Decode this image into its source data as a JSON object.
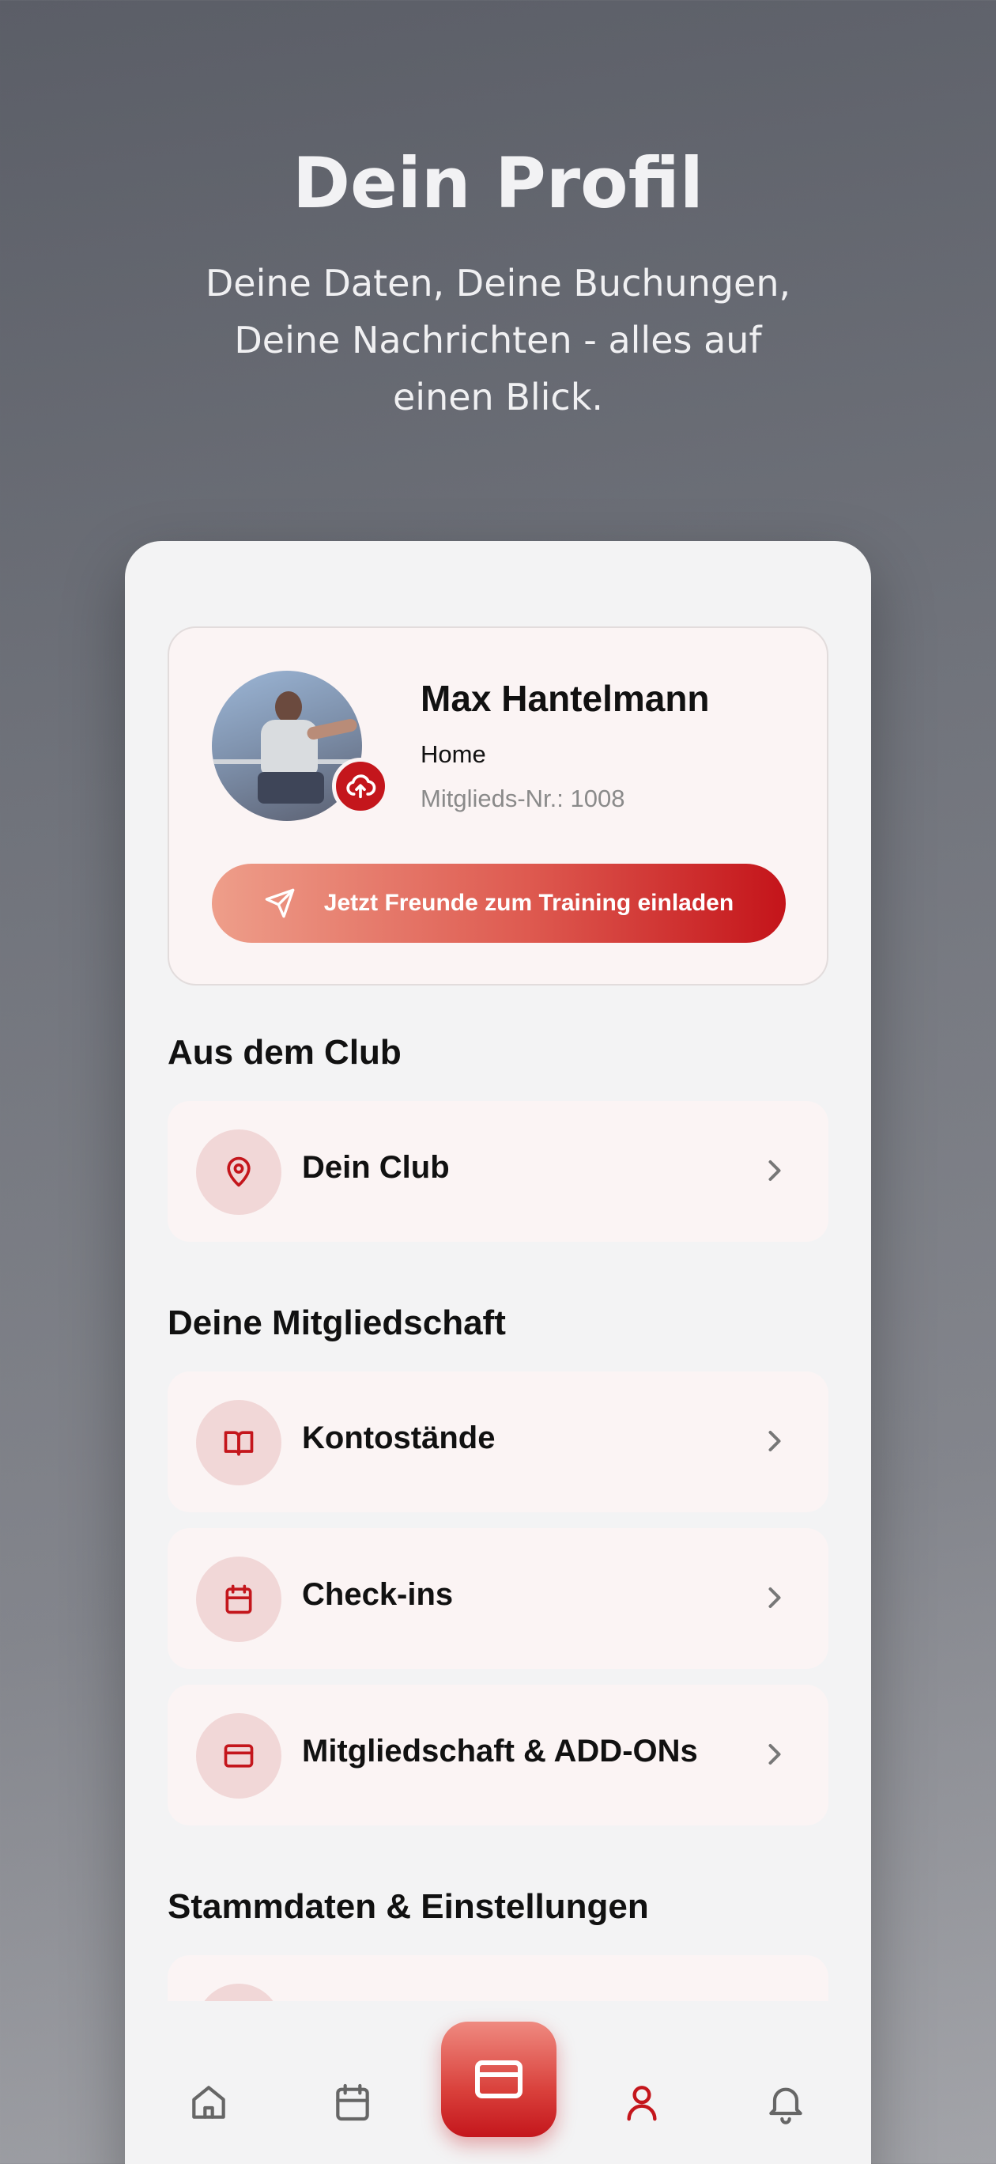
{
  "header": {
    "title": "Dein Profil",
    "subtitle": "Deine Daten, Deine Buchungen, Deine Nachrichten - alles auf einen Blick."
  },
  "profile": {
    "name": "Max Hantelmann",
    "location": "Home",
    "member_number": "Mitglieds-Nr.: 1008",
    "invite_label": "Jetzt Freunde zum Training einladen"
  },
  "sections": {
    "club_title": "Aus dem Club",
    "membership_title": "Deine Mitgliedschaft",
    "settings_title": "Stammdaten & Einstellungen"
  },
  "rows": {
    "club": "Dein Club",
    "balances": "Kontostände",
    "checkins": "Check-ins",
    "membership": "Mitgliedschaft & ADD-ONs"
  },
  "colors": {
    "accent": "#c4161c",
    "icon_bg": "#f1d7d7",
    "card_bg": "#fbf4f4"
  },
  "nav": {
    "items": [
      "home-icon",
      "calendar-icon",
      "card-icon",
      "user-icon",
      "bell-icon"
    ],
    "active": "user-icon"
  }
}
